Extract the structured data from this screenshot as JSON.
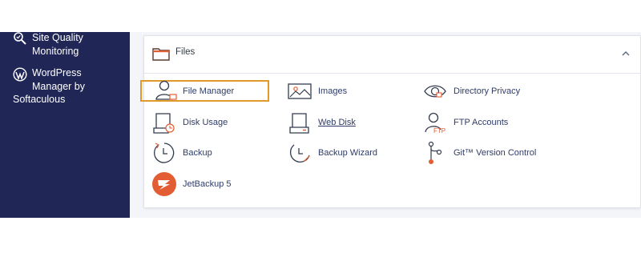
{
  "sidebar": {
    "items": [
      {
        "label_line1": "Site Quality",
        "label_line2": "Monitoring",
        "icon": "magnifier-icon"
      },
      {
        "label_line1": "WordPress",
        "label_line2": "Manager by",
        "label_line3": "Softaculous",
        "icon": "wordpress-icon"
      }
    ]
  },
  "files_panel": {
    "title": "Files",
    "collapse_icon": "chevron-up-icon",
    "tiles": [
      {
        "label": "File Manager",
        "icon": "file-manager-icon",
        "selected": true
      },
      {
        "label": "Images",
        "icon": "images-icon"
      },
      {
        "label": "Directory Privacy",
        "icon": "eye-icon"
      },
      {
        "label": "Disk Usage",
        "icon": "disk-usage-icon"
      },
      {
        "label": "Web Disk",
        "icon": "web-disk-icon",
        "underlined": true
      },
      {
        "label": "FTP Accounts",
        "icon": "ftp-accounts-icon"
      },
      {
        "label": "Backup",
        "icon": "backup-icon"
      },
      {
        "label": "Backup Wizard",
        "icon": "backup-wizard-icon"
      },
      {
        "label": "Git™ Version Control",
        "icon": "git-icon"
      },
      {
        "label": "JetBackup 5",
        "icon": "jetbackup-icon"
      }
    ]
  },
  "colors": {
    "sidebar_bg": "#202656",
    "highlight_border": "#e09a2a",
    "icon_accent": "#e25d33",
    "link_text": "#2f3c68"
  }
}
